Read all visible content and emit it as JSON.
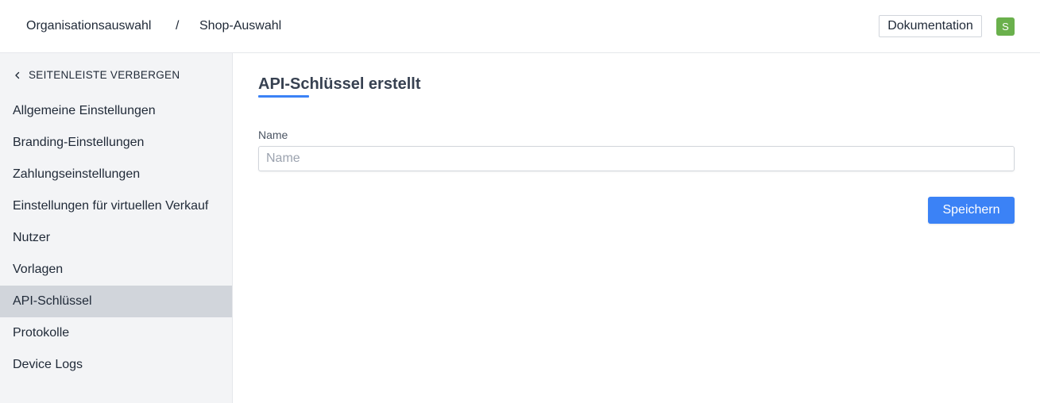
{
  "header": {
    "breadcrumb": [
      "Organisationsauswahl",
      "Shop-Auswahl"
    ],
    "separator": "/",
    "docs_button": "Dokumentation",
    "avatar_initial": "S"
  },
  "sidebar": {
    "hide_label": "SEITENLEISTE VERBERGEN",
    "hide_icon": "chevron-left-icon",
    "items": [
      {
        "label": "Allgemeine Einstellungen",
        "active": false
      },
      {
        "label": "Branding-Einstellungen",
        "active": false
      },
      {
        "label": "Zahlungseinstellungen",
        "active": false
      },
      {
        "label": "Einstellungen für virtuellen Verkauf",
        "active": false
      },
      {
        "label": "Nutzer",
        "active": false
      },
      {
        "label": "Vorlagen",
        "active": false
      },
      {
        "label": "API-Schlüssel",
        "active": true
      },
      {
        "label": "Protokolle",
        "active": false
      },
      {
        "label": "Device Logs",
        "active": false
      }
    ]
  },
  "main": {
    "title": "API-Schlüssel erstellt",
    "name_field": {
      "label": "Name",
      "placeholder": "Name",
      "value": ""
    },
    "save_button": "Speichern"
  },
  "colors": {
    "accent": "#3b82f6",
    "avatar": "#6ab04c",
    "active_nav": "#d1d5db",
    "sidebar_bg": "#f3f4f6"
  }
}
